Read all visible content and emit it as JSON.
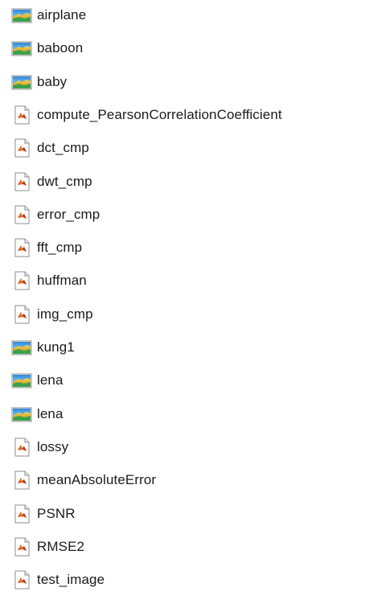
{
  "files": [
    {
      "name": "airplane",
      "type": "image"
    },
    {
      "name": "baboon",
      "type": "image"
    },
    {
      "name": "baby",
      "type": "image"
    },
    {
      "name": "compute_PearsonCorrelationCoefficient",
      "type": "matlab"
    },
    {
      "name": "dct_cmp",
      "type": "matlab"
    },
    {
      "name": "dwt_cmp",
      "type": "matlab"
    },
    {
      "name": "error_cmp",
      "type": "matlab"
    },
    {
      "name": "fft_cmp",
      "type": "matlab"
    },
    {
      "name": "huffman",
      "type": "matlab"
    },
    {
      "name": "img_cmp",
      "type": "matlab"
    },
    {
      "name": "kung1",
      "type": "image"
    },
    {
      "name": "lena",
      "type": "image"
    },
    {
      "name": "lena",
      "type": "image"
    },
    {
      "name": "lossy",
      "type": "matlab"
    },
    {
      "name": "meanAbsoluteError",
      "type": "matlab"
    },
    {
      "name": "PSNR",
      "type": "matlab"
    },
    {
      "name": "RMSE2",
      "type": "matlab"
    },
    {
      "name": "test_image",
      "type": "matlab"
    }
  ],
  "icons": {
    "image": "image-file-icon",
    "matlab": "matlab-file-icon"
  }
}
